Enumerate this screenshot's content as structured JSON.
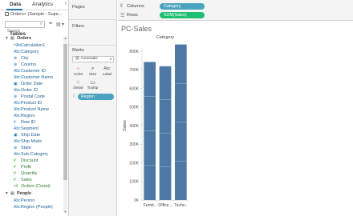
{
  "tabs": {
    "data": "Data",
    "analytics": "Analytics"
  },
  "datasource": "Orders+ (Sample - Supe...",
  "search": {
    "placeholder": "Search"
  },
  "tables_heading": "Tables",
  "groups": [
    {
      "name": "Orders",
      "fields": [
        {
          "label": "Calculation1",
          "kind": "dim",
          "type": "=Abc"
        },
        {
          "label": "Category",
          "kind": "dim",
          "type": "Abc"
        },
        {
          "label": "City",
          "kind": "dim",
          "type": "geo"
        },
        {
          "label": "Country",
          "kind": "dim",
          "type": "geo"
        },
        {
          "label": "Customer ID",
          "kind": "dim",
          "type": "Abc"
        },
        {
          "label": "Customer Name",
          "kind": "dim",
          "type": "Abc"
        },
        {
          "label": "Order Date",
          "kind": "dim",
          "type": "date"
        },
        {
          "label": "Order ID",
          "kind": "dim",
          "type": "Abc"
        },
        {
          "label": "Postal Code",
          "kind": "dim",
          "type": "geo"
        },
        {
          "label": "Product ID",
          "kind": "dim",
          "type": "Abc"
        },
        {
          "label": "Product Name",
          "kind": "dim",
          "type": "Abc"
        },
        {
          "label": "Region",
          "kind": "dim",
          "type": "Abc"
        },
        {
          "label": "Row ID",
          "kind": "dim",
          "type": "#"
        },
        {
          "label": "Segment",
          "kind": "dim",
          "type": "Abc"
        },
        {
          "label": "Ship Date",
          "kind": "dim",
          "type": "date"
        },
        {
          "label": "Ship Mode",
          "kind": "dim",
          "type": "Abc"
        },
        {
          "label": "State",
          "kind": "dim",
          "type": "geo"
        },
        {
          "label": "Sub-Category",
          "kind": "dim",
          "type": "Abc"
        },
        {
          "label": "Discount",
          "kind": "meas",
          "type": "#"
        },
        {
          "label": "Profit",
          "kind": "meas",
          "type": "#"
        },
        {
          "label": "Quantity",
          "kind": "meas",
          "type": "#"
        },
        {
          "label": "Sales",
          "kind": "meas",
          "type": "#"
        },
        {
          "label": "Orders (Count)",
          "kind": "meas",
          "type": "=#",
          "italic": true
        }
      ]
    },
    {
      "name": "People",
      "fields": [
        {
          "label": "Person",
          "kind": "dim",
          "type": "Abc"
        },
        {
          "label": "Region (People)",
          "kind": "dim",
          "type": "Abc"
        }
      ]
    }
  ],
  "cards": {
    "pages": "Pages",
    "filters": "Filters",
    "marks": "Marks",
    "marks_type": "Automatic",
    "buttons": {
      "color": "Color",
      "size": "Size",
      "label": "Label",
      "detail": "Detail",
      "tooltip": "Tooltip"
    },
    "region_pill": "Region"
  },
  "shelves": {
    "columns_label": "Columns",
    "columns_pill": "Category",
    "rows_label": "Rows",
    "rows_pill": "SUM(Sales)"
  },
  "sheet_title": "PC-Sales",
  "chart_data": {
    "type": "bar",
    "header": "Category",
    "categories": [
      "Furnit..",
      "Office ..",
      "Techn.."
    ],
    "values": [
      742000,
      719047,
      836154
    ],
    "segments": [
      4
    ],
    "ylabel": "Sales",
    "ylim": [
      0,
      800000
    ],
    "yticks": [
      0,
      100000,
      200000,
      300000,
      400000,
      500000,
      600000,
      700000,
      800000
    ],
    "ytick_labels": [
      "0K",
      "100K",
      "200K",
      "300K",
      "400K",
      "500K",
      "600K",
      "700K",
      "800K"
    ],
    "bar_color": "#4e79a7",
    "segment_line_color": "#8fb0cf",
    "grid": false
  }
}
